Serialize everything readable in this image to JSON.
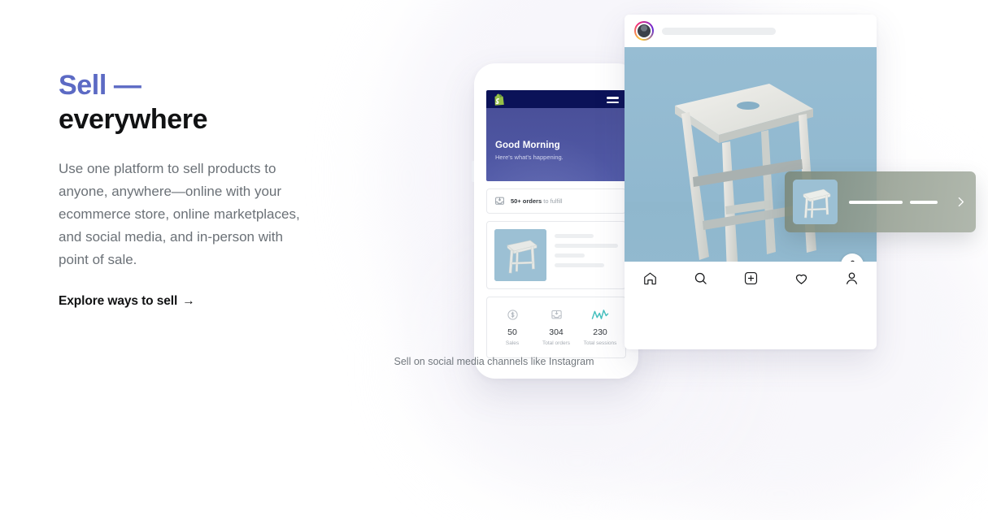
{
  "hero": {
    "headline_accent": "Sell —",
    "headline_rest": "everywhere",
    "body": "Use one platform to sell products to anyone, anywhere—online with your ecommerce store, online marketplaces, and social media, and in-person with point of sale.",
    "cta_label": "Explore ways to sell",
    "cta_arrow": "→",
    "accent_color": "#5c6ac4",
    "text_color": "#111213",
    "body_color": "#6b7177"
  },
  "phone_app": {
    "brand_icon": "shopify-bag-icon",
    "menu_icon": "hamburger-menu-icon",
    "greeting_title": "Good Morning",
    "greeting_subtitle": "Here's what's happening.",
    "orders_icon": "inbox-tray-icon",
    "orders_count": "50+ orders",
    "orders_suffix": " to fulfill",
    "product_thumb_alt": "wooden-stool-thumbnail",
    "stats": [
      {
        "icon": "dollar-circle-icon",
        "value": "50",
        "label": "Sales"
      },
      {
        "icon": "inbox-tray-icon",
        "value": "304",
        "label": "Total orders"
      },
      {
        "icon": "line-chart-icon",
        "value": "230",
        "label": "Total sessions"
      }
    ],
    "header_bg": "#0b1258",
    "hero_bg": "#515aa8"
  },
  "instagram": {
    "avatar_alt": "user-avatar",
    "username_placeholder": "",
    "photo_alt": "wooden-stool-photo",
    "photo_bg": "#92b9d0",
    "shop_bag_icon": "shopping-bag-icon",
    "nav": [
      {
        "icon": "home-icon",
        "label": "Home"
      },
      {
        "icon": "search-icon",
        "label": "Search"
      },
      {
        "icon": "add-post-icon",
        "label": "New post"
      },
      {
        "icon": "heart-icon",
        "label": "Activity"
      },
      {
        "icon": "profile-icon",
        "label": "Profile"
      }
    ],
    "caption": "Sell on social media channels like Instagram"
  },
  "product_tag": {
    "thumb_alt": "wooden-stool-thumbnail",
    "chevron_icon": "chevron-right-icon"
  }
}
